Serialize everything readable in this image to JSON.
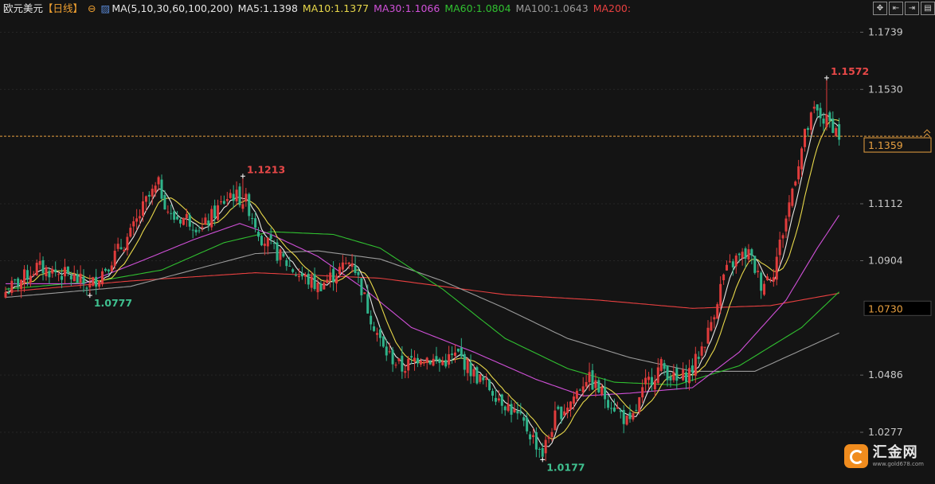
{
  "header": {
    "instrument": "欧元美元",
    "period": "【日线】",
    "ma_params": "MA(5,10,30,60,100,200)",
    "ma_values": [
      {
        "label": "MA5:1.1398",
        "color": "#e6e6e6"
      },
      {
        "label": "MA10:1.1377",
        "color": "#e8d84a"
      },
      {
        "label": "MA30:1.1066",
        "color": "#d050d8"
      },
      {
        "label": "MA60:1.0804",
        "color": "#30c030"
      },
      {
        "label": "MA100:1.0643",
        "color": "#9a9a9a"
      },
      {
        "label": "MA200:",
        "color": "#e84040"
      }
    ]
  },
  "toolbar": [
    "move",
    "first",
    "last",
    "chart"
  ],
  "logo": {
    "name": "汇金网",
    "url": "www.gold678.com"
  },
  "chart_data": {
    "type": "candlestick",
    "y_axis": {
      "range": [
        1.0152,
        1.1781
      ],
      "ticks": [
        "1.1739",
        "1.1530",
        "1.1112",
        "1.0904",
        "1.0486",
        "1.0277"
      ]
    },
    "current_price": {
      "label": "1.1359",
      "value": 1.1359
    },
    "marked_price": {
      "label": "1.0730",
      "value": 1.073
    },
    "annotations": [
      {
        "text": "1.0777",
        "index": 27,
        "value": 1.0777,
        "type": "low"
      },
      {
        "text": "1.1213",
        "index": 76,
        "value": 1.1213,
        "type": "high"
      },
      {
        "text": "1.0177",
        "index": 172,
        "value": 1.0177,
        "type": "low"
      },
      {
        "text": "1.1572",
        "index": 263,
        "value": 1.1572,
        "type": "high"
      }
    ],
    "colors": {
      "up": "#e03c3c",
      "down": "#2fb38a"
    },
    "close_anchors": [
      [
        0,
        1.079
      ],
      [
        10,
        1.088
      ],
      [
        20,
        1.085
      ],
      [
        27,
        1.081
      ],
      [
        32,
        1.088
      ],
      [
        40,
        1.1
      ],
      [
        45,
        1.112
      ],
      [
        49,
        1.118
      ],
      [
        53,
        1.106
      ],
      [
        58,
        1.106
      ],
      [
        63,
        1.102
      ],
      [
        67,
        1.108
      ],
      [
        72,
        1.115
      ],
      [
        77,
        1.112
      ],
      [
        82,
        1.099
      ],
      [
        87,
        1.093
      ],
      [
        93,
        1.086
      ],
      [
        100,
        1.081
      ],
      [
        106,
        1.086
      ],
      [
        111,
        1.091
      ],
      [
        116,
        1.073
      ],
      [
        121,
        1.058
      ],
      [
        127,
        1.051
      ],
      [
        133,
        1.056
      ],
      [
        139,
        1.053
      ],
      [
        145,
        1.056
      ],
      [
        150,
        1.049
      ],
      [
        156,
        1.043
      ],
      [
        162,
        1.036
      ],
      [
        167,
        1.029
      ],
      [
        172,
        1.02
      ],
      [
        176,
        1.033
      ],
      [
        181,
        1.039
      ],
      [
        186,
        1.048
      ],
      [
        191,
        1.042
      ],
      [
        196,
        1.036
      ],
      [
        200,
        1.03
      ],
      [
        205,
        1.045
      ],
      [
        210,
        1.052
      ],
      [
        215,
        1.046
      ],
      [
        220,
        1.051
      ],
      [
        225,
        1.064
      ],
      [
        230,
        1.085
      ],
      [
        234,
        1.091
      ],
      [
        238,
        1.093
      ],
      [
        242,
        1.082
      ],
      [
        246,
        1.087
      ],
      [
        250,
        1.106
      ],
      [
        253,
        1.122
      ],
      [
        256,
        1.136
      ],
      [
        259,
        1.145
      ],
      [
        262,
        1.142
      ],
      [
        265,
        1.14
      ],
      [
        267,
        1.136
      ]
    ],
    "ma_curves": {
      "ma30": [
        [
          0,
          1.082
        ],
        [
          25,
          1.082
        ],
        [
          45,
          1.091
        ],
        [
          60,
          1.098
        ],
        [
          75,
          1.104
        ],
        [
          85,
          1.1
        ],
        [
          100,
          1.092
        ],
        [
          115,
          1.08
        ],
        [
          130,
          1.066
        ],
        [
          150,
          1.057
        ],
        [
          170,
          1.047
        ],
        [
          185,
          1.041
        ],
        [
          200,
          1.042
        ],
        [
          220,
          1.044
        ],
        [
          235,
          1.057
        ],
        [
          250,
          1.076
        ],
        [
          260,
          1.095
        ],
        [
          267,
          1.107
        ]
      ],
      "ma60": [
        [
          0,
          1.08
        ],
        [
          30,
          1.083
        ],
        [
          50,
          1.087
        ],
        [
          70,
          1.097
        ],
        [
          85,
          1.101
        ],
        [
          105,
          1.1
        ],
        [
          120,
          1.095
        ],
        [
          140,
          1.08
        ],
        [
          160,
          1.062
        ],
        [
          180,
          1.051
        ],
        [
          195,
          1.046
        ],
        [
          215,
          1.045
        ],
        [
          235,
          1.052
        ],
        [
          255,
          1.066
        ],
        [
          267,
          1.079
        ]
      ],
      "ma100": [
        [
          0,
          1.077
        ],
        [
          40,
          1.081
        ],
        [
          60,
          1.087
        ],
        [
          80,
          1.093
        ],
        [
          100,
          1.094
        ],
        [
          120,
          1.091
        ],
        [
          140,
          1.083
        ],
        [
          160,
          1.073
        ],
        [
          180,
          1.062
        ],
        [
          200,
          1.055
        ],
        [
          220,
          1.05
        ],
        [
          240,
          1.05
        ],
        [
          267,
          1.064
        ]
      ],
      "ma200": [
        [
          0,
          1.079
        ],
        [
          40,
          1.083
        ],
        [
          80,
          1.086
        ],
        [
          120,
          1.084
        ],
        [
          160,
          1.078
        ],
        [
          190,
          1.076
        ],
        [
          220,
          1.073
        ],
        [
          245,
          1.074
        ],
        [
          267,
          1.0785
        ]
      ]
    }
  }
}
